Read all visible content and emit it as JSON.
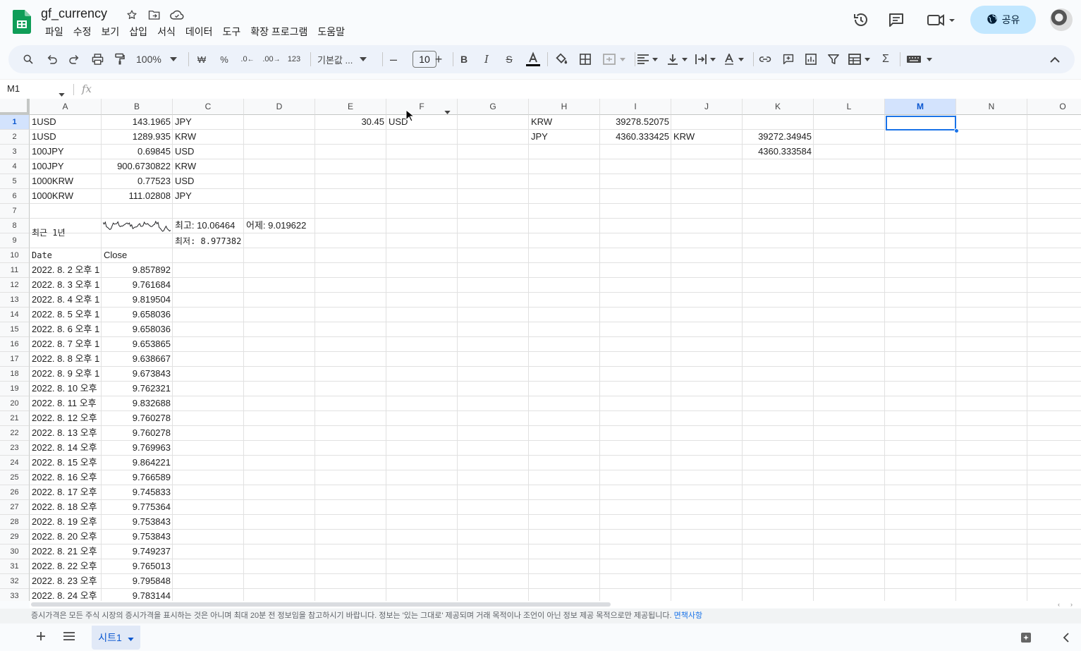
{
  "app": {
    "doc_title": "gf_currency",
    "menu": [
      "파일",
      "수정",
      "보기",
      "삽입",
      "서식",
      "데이터",
      "도구",
      "확장 프로그램",
      "도움말"
    ],
    "share_label": "공유"
  },
  "toolbar": {
    "zoom": "100%",
    "currency_label": "₩",
    "percent_label": "%",
    "dec_decrease_label": ".0",
    "dec_increase_label": ".00",
    "format_123_label": "123",
    "font_name": "기본값 ...",
    "font_size": "10"
  },
  "formula_bar": {
    "name_box": "M1",
    "fx_label": "fx",
    "value": ""
  },
  "columns": [
    "A",
    "B",
    "C",
    "D",
    "E",
    "F",
    "G",
    "H",
    "I",
    "J",
    "K",
    "L",
    "M",
    "N",
    "O"
  ],
  "selected_column": "M",
  "rows": [
    "1",
    "2",
    "3",
    "4",
    "5",
    "6",
    "7",
    "8",
    "9",
    "10",
    "11",
    "12",
    "13",
    "14",
    "15",
    "16",
    "17",
    "18",
    "19",
    "20",
    "21",
    "22",
    "23",
    "24",
    "25",
    "26",
    "27",
    "28",
    "29",
    "30",
    "31",
    "32",
    "33"
  ],
  "cells": {
    "A1": "1USD",
    "B1": "143.1965",
    "C1": "JPY",
    "E1": "30.45",
    "F1": "USD",
    "H1": "KRW",
    "I1": "39278.52075",
    "A2": "1USD",
    "B2": "1289.935",
    "C2": "KRW",
    "H2": "JPY",
    "I2": "4360.333425",
    "J2": "KRW",
    "K2": "39272.34945",
    "A3": "100JPY",
    "B3": "0.69845",
    "C3": "USD",
    "K3": "4360.333584",
    "A4": "100JPY",
    "B4": "900.6730822",
    "C4": "KRW",
    "A5": "1000KRW",
    "B5": "0.77523",
    "C5": "USD",
    "A6": "1000KRW",
    "B6": "111.02808",
    "C6": "JPY",
    "A8": "최근 1년",
    "C8": "최고: 10.06464",
    "D8": "어제: 9.019622",
    "C9": "최저: 8.977382",
    "A10": "Date",
    "B10": "Close"
  },
  "history": [
    {
      "date": "2022. 8. 2 오후 1",
      "close": "9.857892"
    },
    {
      "date": "2022. 8. 3 오후 1",
      "close": "9.761684"
    },
    {
      "date": "2022. 8. 4 오후 1",
      "close": "9.819504"
    },
    {
      "date": "2022. 8. 5 오후 1",
      "close": "9.658036"
    },
    {
      "date": "2022. 8. 6 오후 1",
      "close": "9.658036"
    },
    {
      "date": "2022. 8. 7 오후 1",
      "close": "9.653865"
    },
    {
      "date": "2022. 8. 8 오후 1",
      "close": "9.638667"
    },
    {
      "date": "2022. 8. 9 오후 1",
      "close": "9.673843"
    },
    {
      "date": "2022. 8. 10 오후",
      "close": "9.762321"
    },
    {
      "date": "2022. 8. 11 오후",
      "close": "9.832688"
    },
    {
      "date": "2022. 8. 12 오후",
      "close": "9.760278"
    },
    {
      "date": "2022. 8. 13 오후",
      "close": "9.760278"
    },
    {
      "date": "2022. 8. 14 오후",
      "close": "9.769963"
    },
    {
      "date": "2022. 8. 15 오후",
      "close": "9.864221"
    },
    {
      "date": "2022. 8. 16 오후",
      "close": "9.766589"
    },
    {
      "date": "2022. 8. 17 오후",
      "close": "9.745833"
    },
    {
      "date": "2022. 8. 18 오후",
      "close": "9.775364"
    },
    {
      "date": "2022. 8. 19 오후",
      "close": "9.753843"
    },
    {
      "date": "2022. 8. 20 오후",
      "close": "9.753843"
    },
    {
      "date": "2022. 8. 21 오후",
      "close": "9.749237"
    },
    {
      "date": "2022. 8. 22 오후",
      "close": "9.765013"
    },
    {
      "date": "2022. 8. 23 오후",
      "close": "9.795848"
    },
    {
      "date": "2022. 8. 24 오후",
      "close": "9.783144"
    }
  ],
  "disclaimer": {
    "text": "증시가격은 모든 주식 시장의 증시가격을 표시하는 것은 아니며 최대 20분 전 정보임을 참고하시기 바랍니다. 정보는 '있는 그대로' 제공되며 거래 목적이나 조언이 아닌 정보 제공 목적으로만 제공됩니다. ",
    "link": "면책사항"
  },
  "sheet_tabs": [
    {
      "label": "시트1",
      "active": true
    }
  ],
  "colors": {
    "accent": "#1a73e8",
    "share_bg": "#c2e7ff",
    "sheets_green": "#0f9d58"
  }
}
